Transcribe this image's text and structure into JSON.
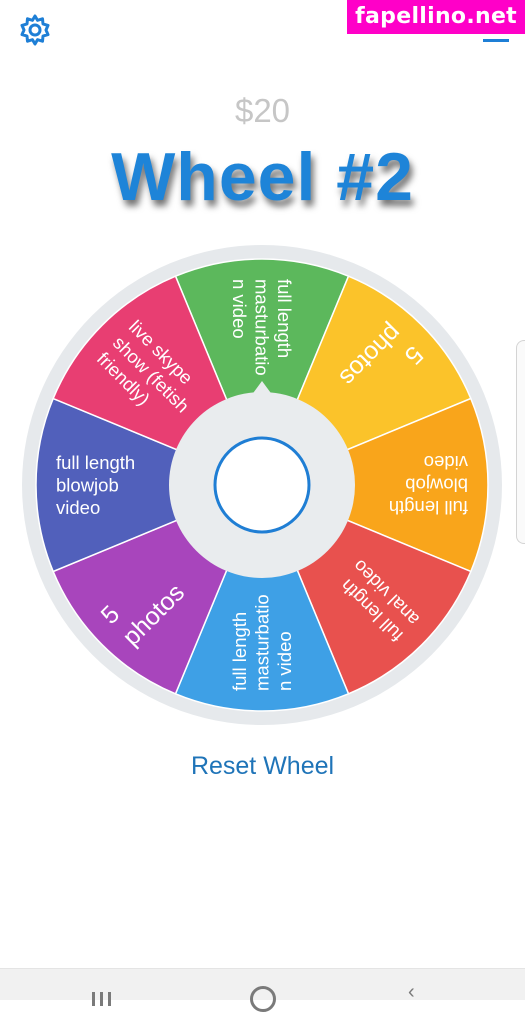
{
  "header": {
    "settings_icon": "gear-icon",
    "menu_icon": "menu-icon",
    "watermark": "fapellino.net"
  },
  "wheel": {
    "price": "$20",
    "title": "Wheel #2",
    "segments": [
      {
        "lines": [
          "full length",
          "masturbatio",
          "n video"
        ],
        "color": "#5cb85c"
      },
      {
        "lines": [
          "5",
          "photos"
        ],
        "color": "#fbc32a"
      },
      {
        "lines": [
          "full length",
          "blowjob",
          "video"
        ],
        "color": "#f9a51b"
      },
      {
        "lines": [
          "full length",
          "anal video"
        ],
        "color": "#e8514e"
      },
      {
        "lines": [
          "full length",
          "masturbatio",
          "n video"
        ],
        "color": "#3ea0e6"
      },
      {
        "lines": [
          "5",
          "photos"
        ],
        "color": "#a845bc"
      },
      {
        "lines": [
          "full length",
          "blowjob",
          "video"
        ],
        "color": "#5160bb"
      },
      {
        "lines": [
          "live skype",
          "show (fetish",
          "friendly)"
        ],
        "color": "#e83e72"
      }
    ],
    "colors": {
      "rim": "#e6e9ec",
      "hub": "#e9ecee",
      "spin_button_ring": "#1f7ed4"
    }
  },
  "actions": {
    "reset_label": "Reset Wheel"
  }
}
